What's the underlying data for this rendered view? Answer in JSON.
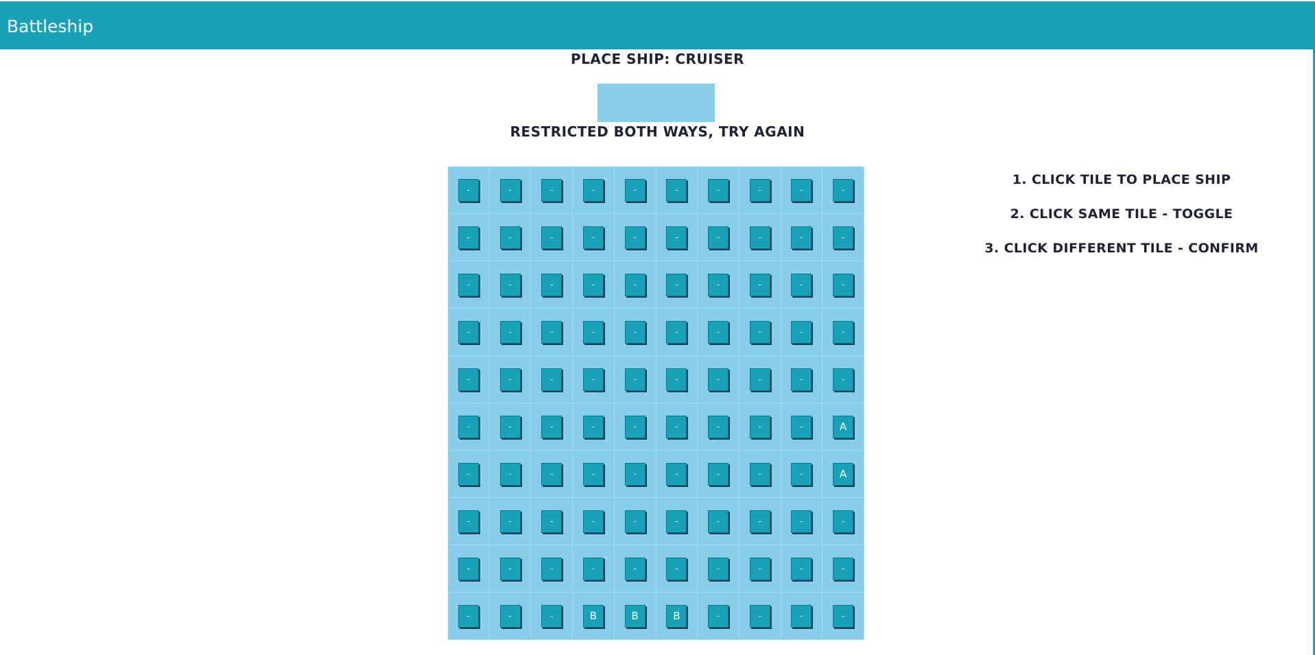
{
  "app": {
    "title": "Battleship"
  },
  "placement": {
    "title": "Place Ship: Cruiser",
    "status": "Restricted both ways, try again"
  },
  "instructions": [
    "1. Click tile to place ship",
    "2. Click same tile - toggle",
    "3. Click different tile - confirm"
  ],
  "board": {
    "rows": [
      [
        "-",
        "-",
        "-",
        "-",
        "-",
        "-",
        "-",
        "-",
        "-",
        "-"
      ],
      [
        "-",
        "-",
        "-",
        "-",
        "-",
        "-",
        "-",
        "-",
        "-",
        "-"
      ],
      [
        "-",
        "-",
        "-",
        "-",
        "-",
        "-",
        "-",
        "-",
        "-",
        "-"
      ],
      [
        "-",
        "-",
        "-",
        "-",
        "-",
        "-",
        "-",
        "-",
        "-",
        "-"
      ],
      [
        "-",
        "-",
        "-",
        "-",
        "-",
        "-",
        "-",
        "-",
        "-",
        "-"
      ],
      [
        "-",
        "-",
        "-",
        "-",
        "-",
        "-",
        "-",
        "-",
        "-",
        "A"
      ],
      [
        "-",
        "-",
        "-",
        "-",
        "-",
        "-",
        "-",
        "-",
        "-",
        "A"
      ],
      [
        "-",
        "-",
        "-",
        "-",
        "-",
        "-",
        "-",
        "-",
        "-",
        "-"
      ],
      [
        "-",
        "-",
        "-",
        "-",
        "-",
        "-",
        "-",
        "-",
        "-",
        "-"
      ],
      [
        "-",
        "-",
        "-",
        "B",
        "B",
        "B",
        "-",
        "-",
        "-",
        "-"
      ]
    ]
  },
  "colors": {
    "accent": "#17a2b8",
    "board_water": "#87ceeb",
    "text_dark": "#1d2333"
  }
}
